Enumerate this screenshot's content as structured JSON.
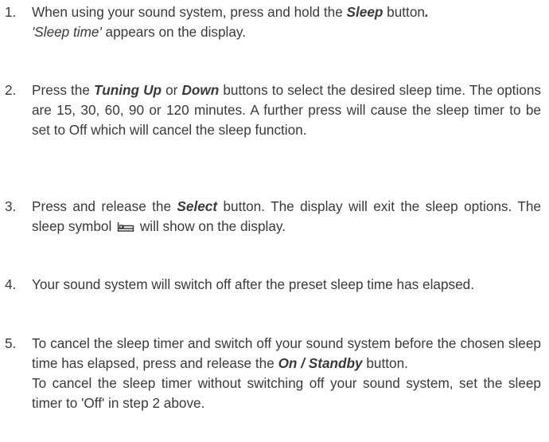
{
  "steps": [
    {
      "number": "1.",
      "p1": "When using your sound system, press and hold the ",
      "b1": "Sleep",
      "p2": " button",
      "b2": ".",
      "line2_italic": "'Sleep time'",
      "line2_rest": " appears on the display."
    },
    {
      "number": "2.",
      "p1": "Press the ",
      "b1": "Tuning Up",
      "p2": " or ",
      "b2": "Down",
      "p3": " buttons to select the desired sleep time. The options are 15, 30, 60, 90 or 120 minutes. A further press will cause the sleep timer to be set to Off which will cancel the sleep function."
    },
    {
      "number": "3.",
      "p1": "Press and release the ",
      "b1": "Select",
      "p2": " button. The display will exit the sleep options. The sleep symbol ",
      "p3": " will show on the display."
    },
    {
      "number": "4.",
      "p1": "Your sound system will switch off after the preset sleep time has elapsed."
    },
    {
      "number": "5.",
      "p1": "To cancel the sleep timer and switch off your sound system before the chosen sleep time has elapsed, press and release the ",
      "b1": "On / Standby",
      "p2": " button.",
      "note": "To cancel the sleep timer without switching off your sound system, set the sleep timer to 'Off' in step 2 above."
    }
  ]
}
